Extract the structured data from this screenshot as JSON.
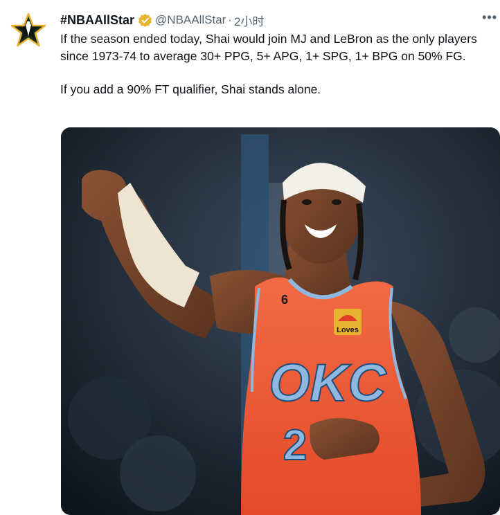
{
  "tweet": {
    "author_name": "#NBAAllStar",
    "handle": "@NBAAllStar",
    "separator": "·",
    "time": "2小时",
    "more_icon": "more-horizontal-icon",
    "verified_icon": "verified-badge-icon",
    "text_paragraph_1": "If the season ended today, Shai would join MJ and LeBron as the only players since 1973-74 to average 30+ PPG, 5+ APG, 1+ SPG, 1+ BPG on 50% FG.",
    "text_paragraph_2": "If you add a 90% FT qualifier, Shai stands alone."
  },
  "media": {
    "jersey_team": "OKC",
    "jersey_number": "2",
    "shoulder_patch": "6",
    "sponsor_patch": "Loves"
  },
  "colors": {
    "verified_gold": "#e8b430",
    "jersey_orange": "#ef5a36",
    "jersey_trim": "#8fb8e0",
    "background_dark": "#16202b"
  }
}
